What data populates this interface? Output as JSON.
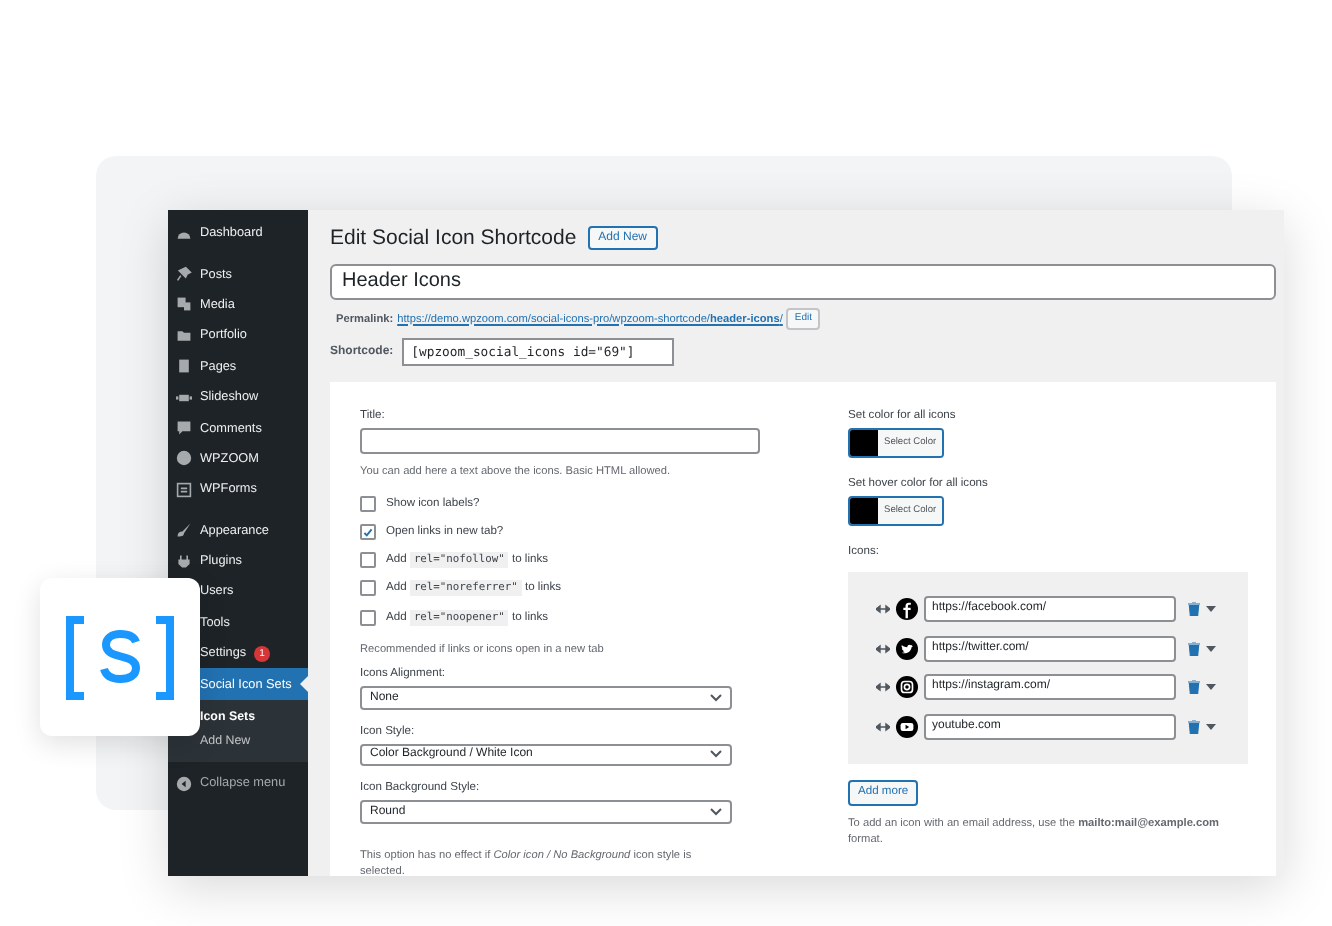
{
  "sidebar": {
    "items": [
      {
        "label": "Dashboard",
        "selected": false
      },
      {
        "label": "Posts",
        "selected": false
      },
      {
        "label": "Media",
        "selected": false
      },
      {
        "label": "Portfolio",
        "selected": false
      },
      {
        "label": "Pages",
        "selected": false
      },
      {
        "label": "Slideshow",
        "selected": false
      },
      {
        "label": "Comments",
        "selected": false
      },
      {
        "label": "WPZOOM",
        "selected": false
      },
      {
        "label": "WPForms",
        "selected": false
      },
      {
        "label": "Appearance",
        "selected": false
      },
      {
        "label": "Plugins",
        "selected": false
      },
      {
        "label": "Users",
        "selected": false
      },
      {
        "label": "Tools",
        "selected": false
      },
      {
        "label": "Settings",
        "badge": "1",
        "selected": false
      },
      {
        "label": "Social Icon Sets",
        "selected": true,
        "children": [
          {
            "label": "Icon Sets",
            "selected": true
          },
          {
            "label": "Add New",
            "selected": false
          }
        ]
      }
    ],
    "collapse": "Collapse menu"
  },
  "heading": {
    "title": "Edit Social Icon Shortcode",
    "button": "Add New"
  },
  "post_title": "Header Icons",
  "permalink": {
    "label": "Permalink:",
    "url_prefix": "https://demo.wpzoom.com/social-icons-pro/wpzoom-shortcode/",
    "slug": "header-icons",
    "url_suffix": "/",
    "button": "Edit"
  },
  "shortcode": {
    "label": "Shortcode:",
    "value": "[wpzoom_social_icons id=\"69\"]"
  },
  "left": {
    "title_label": "Title:",
    "title_help": "You can add here a text above the icons. Basic HTML allowed.",
    "checkboxes": [
      {
        "kind": "plain",
        "label": "Show icon labels?",
        "checked": false
      },
      {
        "kind": "plain",
        "label": "Open links in new tab?",
        "checked": true
      },
      {
        "kind": "code",
        "label": "Add",
        "code": "rel=\"nofollow\"",
        "suffix": "to links",
        "checked": false
      },
      {
        "kind": "code",
        "label": "Add",
        "code": "rel=\"noreferrer\"",
        "suffix": "to links",
        "checked": false
      },
      {
        "kind": "code",
        "label": "Add",
        "code": "rel=\"noopener\"",
        "suffix": "to links",
        "checked": false
      }
    ],
    "note": "Recommended if links or icons open in a new tab",
    "selects": [
      {
        "label": "Icons Alignment:",
        "value": "None"
      },
      {
        "label": "Icon Style:",
        "value": "Color Background / White Icon"
      },
      {
        "label": "Icon Background Style:",
        "value": "Round"
      }
    ],
    "effect_note": "This option has no effect if *Color icon / No Background* icon style is selected."
  },
  "right": {
    "colors": [
      {
        "label": "Set color for all icons",
        "color": "#000000",
        "button": "Select Color"
      },
      {
        "label": "Set hover color for all icons",
        "color": "#000000",
        "button": "Select Color"
      }
    ],
    "icons_label": "Icons:",
    "icons": [
      {
        "kind": "facebook",
        "url": "https://facebook.com/"
      },
      {
        "kind": "twitter",
        "url": "https://twitter.com/"
      },
      {
        "kind": "instagram",
        "url": "https://instagram.com/"
      },
      {
        "kind": "youtube",
        "url": "youtube.com"
      }
    ],
    "add_button": "Add more",
    "help": "To add an icon with an email address, use the **mailto:mail@example.com** format."
  }
}
